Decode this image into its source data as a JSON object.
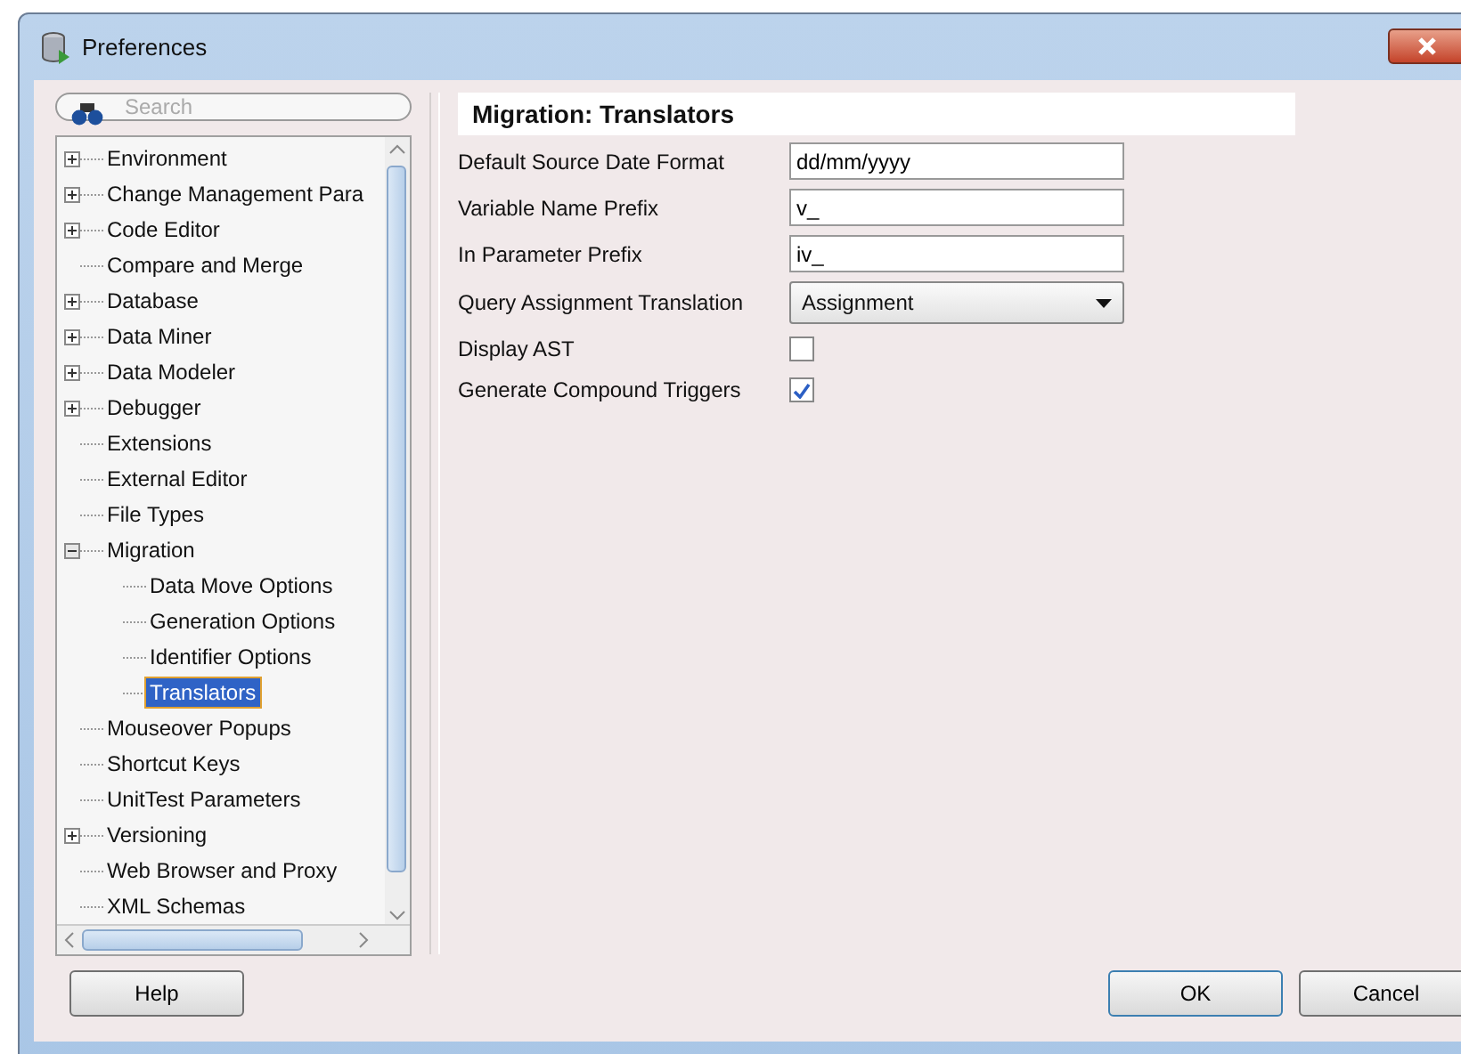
{
  "window": {
    "title": "Preferences"
  },
  "search": {
    "placeholder": "Search"
  },
  "tree": [
    {
      "label": "Environment",
      "kind": "node",
      "expanded": false,
      "selected": false
    },
    {
      "label": "Change Management Para",
      "kind": "node",
      "expanded": false,
      "selected": false
    },
    {
      "label": "Code Editor",
      "kind": "node",
      "expanded": false,
      "selected": false
    },
    {
      "label": "Compare and Merge",
      "kind": "leaf",
      "selected": false
    },
    {
      "label": "Database",
      "kind": "node",
      "expanded": false,
      "selected": false
    },
    {
      "label": "Data Miner",
      "kind": "node",
      "expanded": false,
      "selected": false
    },
    {
      "label": "Data Modeler",
      "kind": "node",
      "expanded": false,
      "selected": false
    },
    {
      "label": "Debugger",
      "kind": "node",
      "expanded": false,
      "selected": false
    },
    {
      "label": "Extensions",
      "kind": "leaf",
      "selected": false
    },
    {
      "label": "External Editor",
      "kind": "leaf",
      "selected": false
    },
    {
      "label": "File Types",
      "kind": "leaf",
      "selected": false
    },
    {
      "label": "Migration",
      "kind": "node",
      "expanded": true,
      "selected": false,
      "children": [
        {
          "label": "Data Move Options",
          "kind": "leaf",
          "selected": false
        },
        {
          "label": "Generation Options",
          "kind": "leaf",
          "selected": false
        },
        {
          "label": "Identifier Options",
          "kind": "leaf",
          "selected": false
        },
        {
          "label": "Translators",
          "kind": "leaf",
          "selected": true
        }
      ]
    },
    {
      "label": "Mouseover Popups",
      "kind": "leaf",
      "selected": false
    },
    {
      "label": "Shortcut Keys",
      "kind": "leaf",
      "selected": false
    },
    {
      "label": "UnitTest Parameters",
      "kind": "leaf",
      "selected": false
    },
    {
      "label": "Versioning",
      "kind": "node",
      "expanded": false,
      "selected": false
    },
    {
      "label": "Web Browser and Proxy",
      "kind": "leaf",
      "selected": false
    },
    {
      "label": "XML Schemas",
      "kind": "leaf",
      "selected": false
    }
  ],
  "panel": {
    "title": "Migration: Translators",
    "fields": [
      {
        "label": "Default Source Date Format",
        "kind": "text",
        "value": "dd/mm/yyyy"
      },
      {
        "label": "Variable Name Prefix",
        "kind": "text",
        "value": "v_"
      },
      {
        "label": "In Parameter Prefix",
        "kind": "text",
        "value": "iv_"
      },
      {
        "label": "Query Assignment Translation",
        "kind": "select",
        "value": "Assignment"
      },
      {
        "label": "Display AST",
        "kind": "checkbox",
        "checked": false
      },
      {
        "label": "Generate Compound Triggers",
        "kind": "checkbox",
        "checked": true
      }
    ]
  },
  "buttons": {
    "help": "Help",
    "ok": "OK",
    "cancel": "Cancel"
  }
}
